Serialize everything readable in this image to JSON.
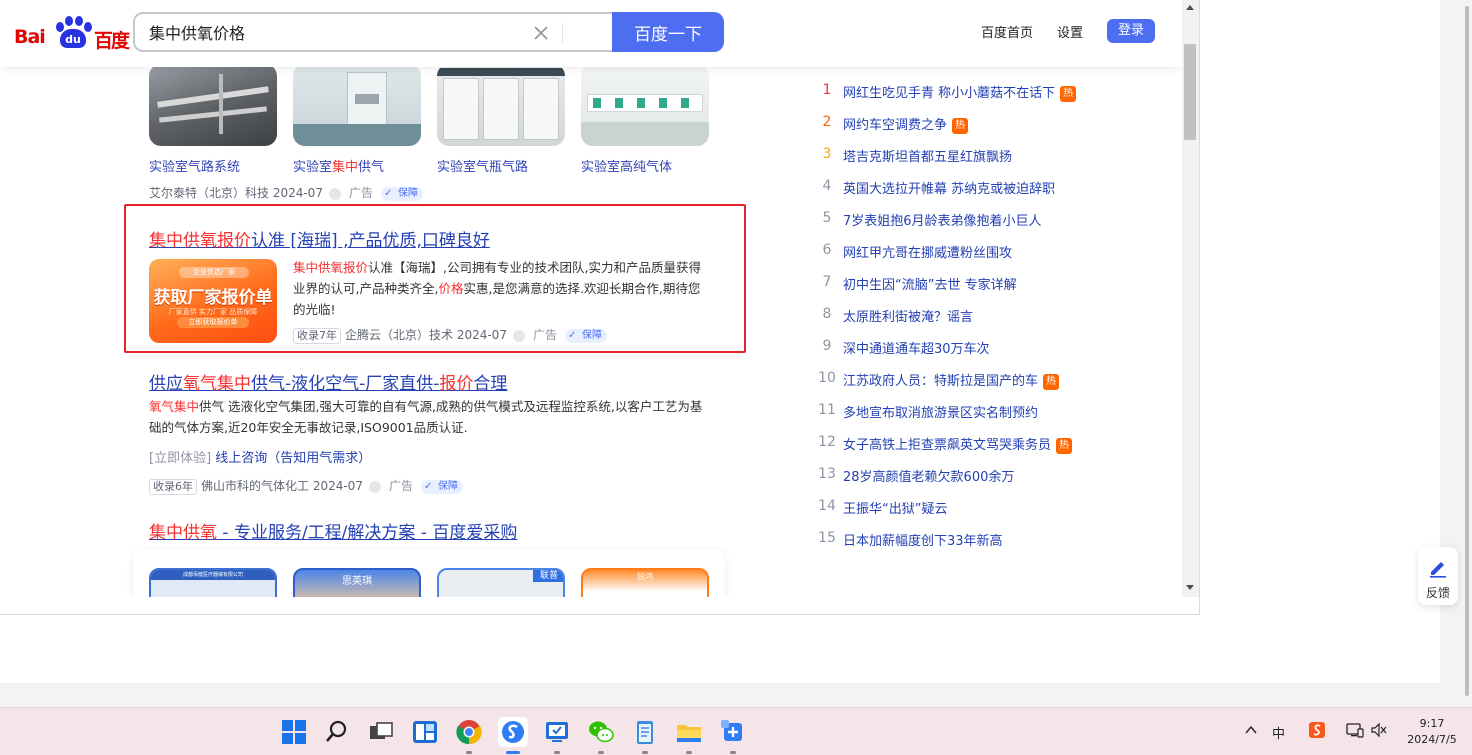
{
  "header": {
    "logo_text_left": "Bai",
    "logo_text_paw": "du",
    "logo_text_right": "百度",
    "search_value": "集中供氧价格",
    "search_button": "百度一下",
    "links": [
      "百度首页",
      "设置"
    ],
    "login_button": "登录"
  },
  "results": {
    "lab_images": {
      "captions": [
        {
          "pre": "实验室气路系统",
          "hl": "",
          "post": ""
        },
        {
          "pre": "实验室",
          "hl": "集中",
          "post": "供气"
        },
        {
          "pre": "实验室气瓶气路",
          "hl": "",
          "post": ""
        },
        {
          "pre": "实验室高纯气体",
          "hl": "",
          "post": ""
        }
      ],
      "meta_source": "艾尔泰特（北京）科技 2024-07",
      "ad_label": "广告",
      "guard_label": "保障"
    },
    "ad_highlighted": {
      "title_hl": "集中供氧报价",
      "title_rest": "认准 [海瑞] ,产品优质,口碑良好",
      "image_texts": [
        "企业优选厂家",
        "获取厂家报价单",
        "厂家直供 实力厂家 品质保障",
        "立即获取报价单"
      ],
      "desc_hl1": "集中供氧报价",
      "desc_part1": "认准【海瑞】,公司拥有专业的技术团队,实力和产品质量获得业界的认可,产品种类齐全,",
      "desc_hl2": "价格",
      "desc_part2": "实惠,是您满意的选择.欢迎长期合作,期待您的光临!",
      "badge": "收录7年",
      "source": "企腾云（北京）技术 2024-07",
      "ad_label": "广告",
      "guard_label": "保障"
    },
    "ad_second": {
      "title_p1": "供应",
      "title_hl1": "氧气集中",
      "title_p2": "供气-液化空气-厂家直供-",
      "title_hl2": "报价",
      "title_p3": "合理",
      "desc_hl": "氧气集中",
      "desc_rest": "供气 选液化空气集团,强大可靠的自有气源,成熟的供气模式及远程监控系统,以客户工艺为基础的气体方案,近20年安全无事故记录,ISO9001品质认证.",
      "sub_prefix": "[立即体验]",
      "sub_link": "线上咨询（告知用气需求）",
      "badge": "收录6年",
      "source": "佛山市科的气体化工 2024-07",
      "ad_label": "广告",
      "guard_label": "保障"
    },
    "aicai": {
      "title_hl": "集中供氧",
      "title_rest": " - 专业服务/工程/解决方案 - 百度爱采购",
      "card_labels": [
        "成都佰健医疗器械有限公司",
        "思英琪",
        "联普",
        "锐鸿"
      ]
    }
  },
  "hot_list": [
    {
      "rank": "1",
      "title": "网红生吃见手青 称小小蘑菇不在话下",
      "tag": "热",
      "rank_color": "#f73131"
    },
    {
      "rank": "2",
      "title": "网约车空调费之争",
      "tag": "热",
      "rank_color": "#ff6600"
    },
    {
      "rank": "3",
      "title": "塔吉克斯坦首都五星红旗飘扬",
      "tag": "",
      "rank_color": "#faa90e"
    },
    {
      "rank": "4",
      "title": "英国大选拉开帷幕 苏纳克或被迫辞职",
      "tag": "",
      "rank_color": "#9195a3"
    },
    {
      "rank": "5",
      "title": "7岁表姐抱6月龄表弟像抱着小巨人",
      "tag": "",
      "rank_color": "#9195a3"
    },
    {
      "rank": "6",
      "title": "网红甲亢哥在挪威遭粉丝围攻",
      "tag": "",
      "rank_color": "#9195a3"
    },
    {
      "rank": "7",
      "title": "初中生因“流脑”去世 专家详解",
      "tag": "",
      "rank_color": "#9195a3"
    },
    {
      "rank": "8",
      "title": "太原胜利街被淹？谣言",
      "tag": "",
      "rank_color": "#9195a3"
    },
    {
      "rank": "9",
      "title": "深中通道通车超30万车次",
      "tag": "",
      "rank_color": "#9195a3"
    },
    {
      "rank": "10",
      "title": "江苏政府人员：特斯拉是国产的车",
      "tag": "热",
      "rank_color": "#9195a3"
    },
    {
      "rank": "11",
      "title": "多地宣布取消旅游景区实名制预约",
      "tag": "",
      "rank_color": "#9195a3"
    },
    {
      "rank": "12",
      "title": "女子高铁上拒查票飙英文骂哭乘务员",
      "tag": "热",
      "rank_color": "#9195a3"
    },
    {
      "rank": "13",
      "title": "28岁高颜值老赖欠款600余万",
      "tag": "",
      "rank_color": "#9195a3"
    },
    {
      "rank": "14",
      "title": "王振华“出狱”疑云",
      "tag": "",
      "rank_color": "#9195a3"
    },
    {
      "rank": "15",
      "title": "日本加薪幅度创下33年新高",
      "tag": "",
      "rank_color": "#9195a3"
    }
  ],
  "feedback": {
    "label": "反馈",
    "icon": "edit-icon"
  },
  "taskbar": {
    "icons": [
      "windows-start-icon",
      "search-icon",
      "task-view-icon",
      "widgets-icon",
      "chrome-icon",
      "sogou-browser-icon",
      "remote-desktop-icon",
      "wechat-icon",
      "notepad-icon",
      "file-explorer-icon",
      "snipping-tool-icon"
    ],
    "tray": {
      "ime": "中",
      "chevron": "^"
    },
    "clock": {
      "time": "9:17",
      "date": "2024/7/5"
    }
  }
}
